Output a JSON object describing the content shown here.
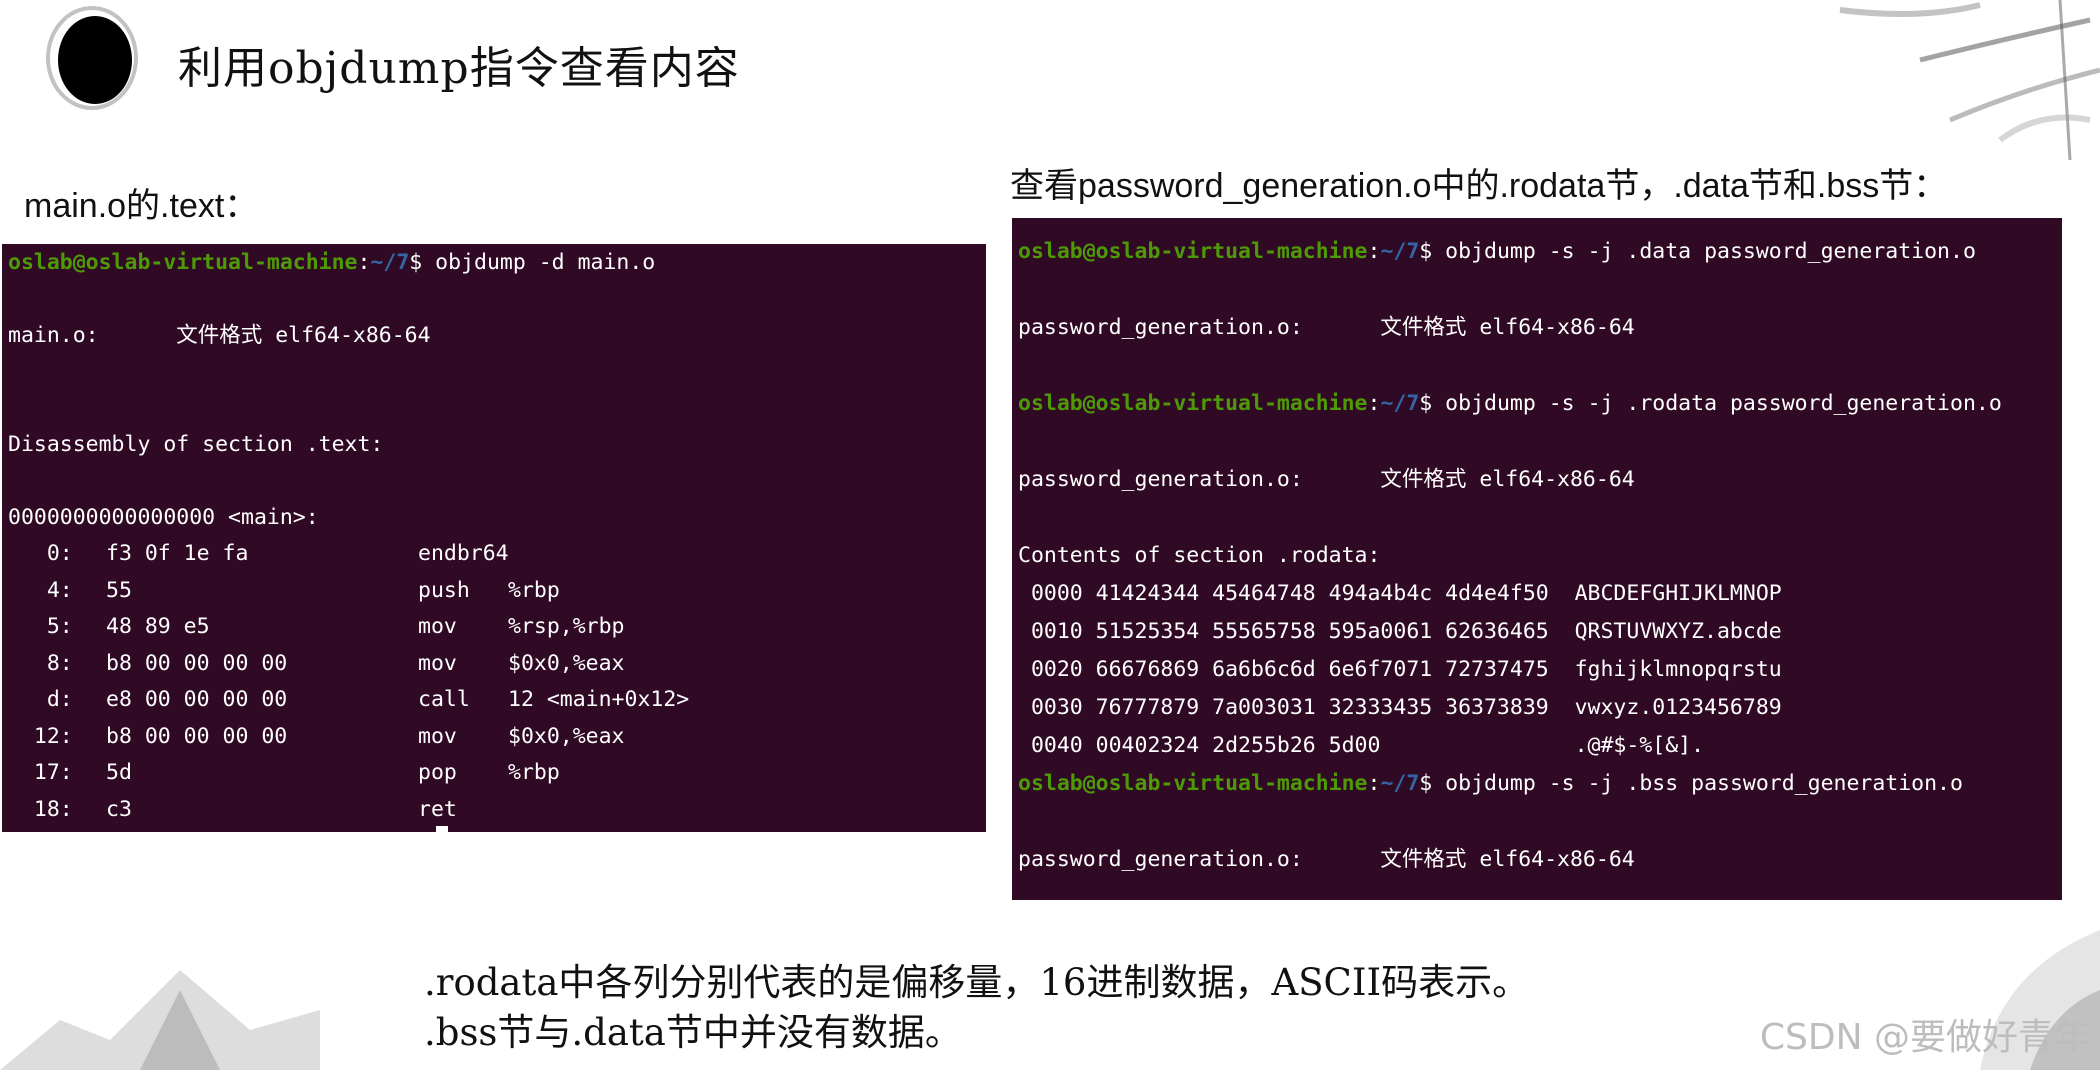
{
  "slide": {
    "title": "利用objdump指令查看内容",
    "left_caption": "main.o的.text：",
    "right_caption": "查看password_generation.o中的.rodata节，.data节和.bss节："
  },
  "left_terminal": {
    "prompt_user": "oslab@oslab-virtual-machine",
    "prompt_path": "~/7",
    "command": "$ objdump -d main.o",
    "file_format_line": "main.o:      文件格式 elf64-x86-64",
    "section_header": "Disassembly of section .text:",
    "symbol_line": "0000000000000000 <main>:",
    "instructions": [
      {
        "addr": "   0:",
        "bytes": "f3 0f 1e fa",
        "mnemonic": "endbr64",
        "operands": ""
      },
      {
        "addr": "   4:",
        "bytes": "55",
        "mnemonic": "push",
        "operands": "%rbp"
      },
      {
        "addr": "   5:",
        "bytes": "48 89 e5",
        "mnemonic": "mov",
        "operands": "%rsp,%rbp"
      },
      {
        "addr": "   8:",
        "bytes": "b8 00 00 00 00",
        "mnemonic": "mov",
        "operands": "$0x0,%eax"
      },
      {
        "addr": "   d:",
        "bytes": "e8 00 00 00 00",
        "mnemonic": "call",
        "operands": "12 <main+0x12>"
      },
      {
        "addr": "  12:",
        "bytes": "b8 00 00 00 00",
        "mnemonic": "mov",
        "operands": "$0x0,%eax"
      },
      {
        "addr": "  17:",
        "bytes": "5d",
        "mnemonic": "pop",
        "operands": "%rbp"
      },
      {
        "addr": "  18:",
        "bytes": "c3",
        "mnemonic": "ret",
        "operands": ""
      }
    ]
  },
  "right_terminal": {
    "prompt_user": "oslab@oslab-virtual-machine",
    "prompt_path": "~/7",
    "cmd_data": "$ objdump -s -j .data password_generation.o",
    "format_line_1": "password_generation.o:      文件格式 elf64-x86-64",
    "cmd_rodata": "$ objdump -s -j .rodata password_generation.o",
    "format_line_2": "password_generation.o:      文件格式 elf64-x86-64",
    "contents_header": "Contents of section .rodata:",
    "dump_rows": [
      " 0000 41424344 45464748 494a4b4c 4d4e4f50  ABCDEFGHIJKLMNOP",
      " 0010 51525354 55565758 595a0061 62636465  QRSTUVWXYZ.abcde",
      " 0020 66676869 6a6b6c6d 6e6f7071 72737475  fghijklmnopqrstu",
      " 0030 76777879 7a003031 32333435 36373839  vwxyz.0123456789",
      " 0040 00402324 2d255b26 5d00               .@#$-%[&]."
    ],
    "cmd_bss": "$ objdump -s -j .bss password_generation.o",
    "format_line_3": "password_generation.o:      文件格式 elf64-x86-64"
  },
  "notes": {
    "line1": ".rodata中各列分别代表的是偏移量，16进制数据，ASCII码表示。",
    "line2": ".bss节与.data节中并没有数据。"
  },
  "watermark": "CSDN @要做好青年",
  "colors": {
    "terminal_bg": "#300a24",
    "prompt_user": "#4e9a06",
    "prompt_path": "#3465a4",
    "text": "#ffffff"
  }
}
